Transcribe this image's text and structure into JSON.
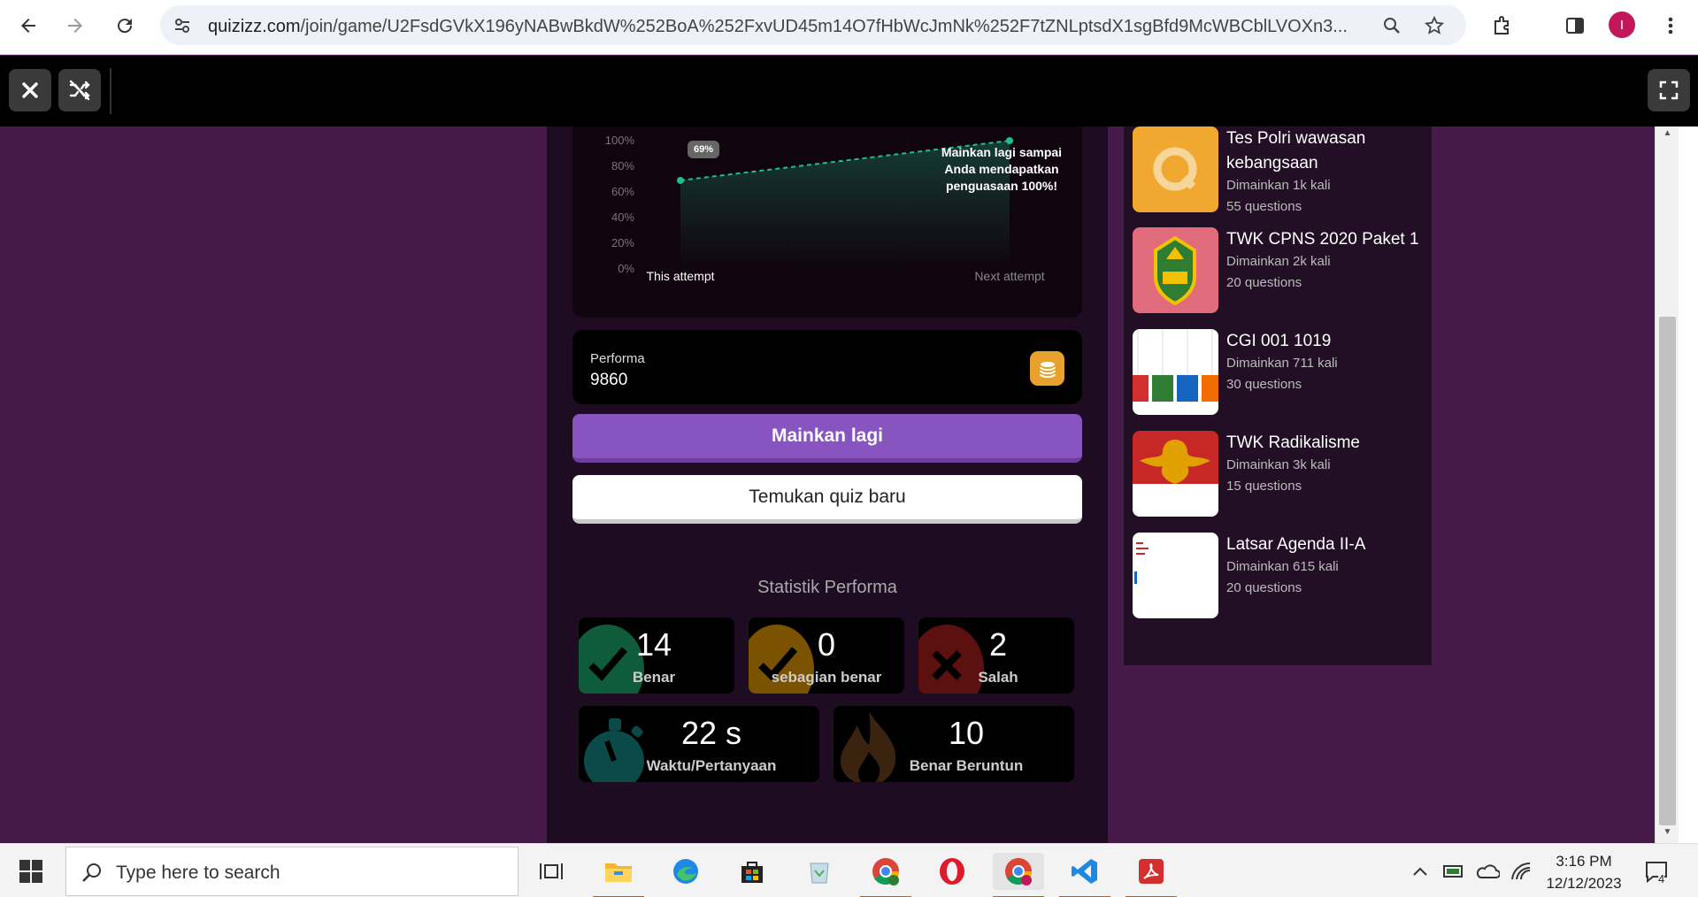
{
  "browser": {
    "url_host": "quizizz.com",
    "url_path": "/join/game/U2FsdGVkX196yNABwBkdW%252BoA%252FxvUD45m14O7fHbWcJmNk%252F7tZNLptsdX1sgBfd9McWBCblLVOXn3...",
    "profile_initial": "I"
  },
  "chart": {
    "badge": "69%",
    "note": "Mainkan lagi sampai Anda mendapatkan penguasaan 100%!",
    "x_this": "This attempt",
    "x_next": "Next attempt"
  },
  "chart_data": {
    "type": "line",
    "categories": [
      "This attempt",
      "Next attempt"
    ],
    "values": [
      69,
      100
    ],
    "y_ticks": [
      "100%",
      "80%",
      "60%",
      "40%",
      "20%",
      "0%"
    ],
    "ylim": [
      0,
      100
    ],
    "annotations": [
      "69%",
      "Mainkan lagi sampai Anda mendapatkan penguasaan 100%!"
    ]
  },
  "performance": {
    "label": "Performa",
    "value": "9860"
  },
  "actions": {
    "play_again": "Mainkan lagi",
    "find_quiz": "Temukan quiz baru"
  },
  "stats": {
    "title": "Statistik Performa",
    "correct": {
      "value": "14",
      "label": "Benar"
    },
    "partial": {
      "value": "0",
      "label": "sebagian benar"
    },
    "wrong": {
      "value": "2",
      "label": "Salah"
    },
    "time": {
      "value": "22 s",
      "label": "Waktu/Pertanyaan"
    },
    "streak": {
      "value": "10",
      "label": "Benar Beruntun"
    }
  },
  "quizzes": [
    {
      "title": "Tes Polri wawasan kebangsaan",
      "plays": "Dimainkan 1k kali",
      "questions": "55 questions"
    },
    {
      "title": "TWK CPNS 2020 Paket 1",
      "plays": "Dimainkan 2k kali",
      "questions": "20 questions"
    },
    {
      "title": "CGI 001 1019",
      "plays": "Dimainkan 711 kali",
      "questions": "30 questions"
    },
    {
      "title": "TWK Radikalisme",
      "plays": "Dimainkan 3k kali",
      "questions": "15 questions"
    },
    {
      "title": "Latsar Agenda II-A",
      "plays": "Dimainkan 615 kali",
      "questions": "20 questions"
    }
  ],
  "taskbar": {
    "search_placeholder": "Type here to search",
    "time": "3:16 PM",
    "date": "12/12/2023",
    "notification_count": "4"
  },
  "colors": {
    "background": "#461a48",
    "panel": "#1e0c22",
    "primary_button": "#8854c0",
    "correct": "#0f5c3a",
    "partial": "#7a5200",
    "wrong": "#5c1010"
  }
}
